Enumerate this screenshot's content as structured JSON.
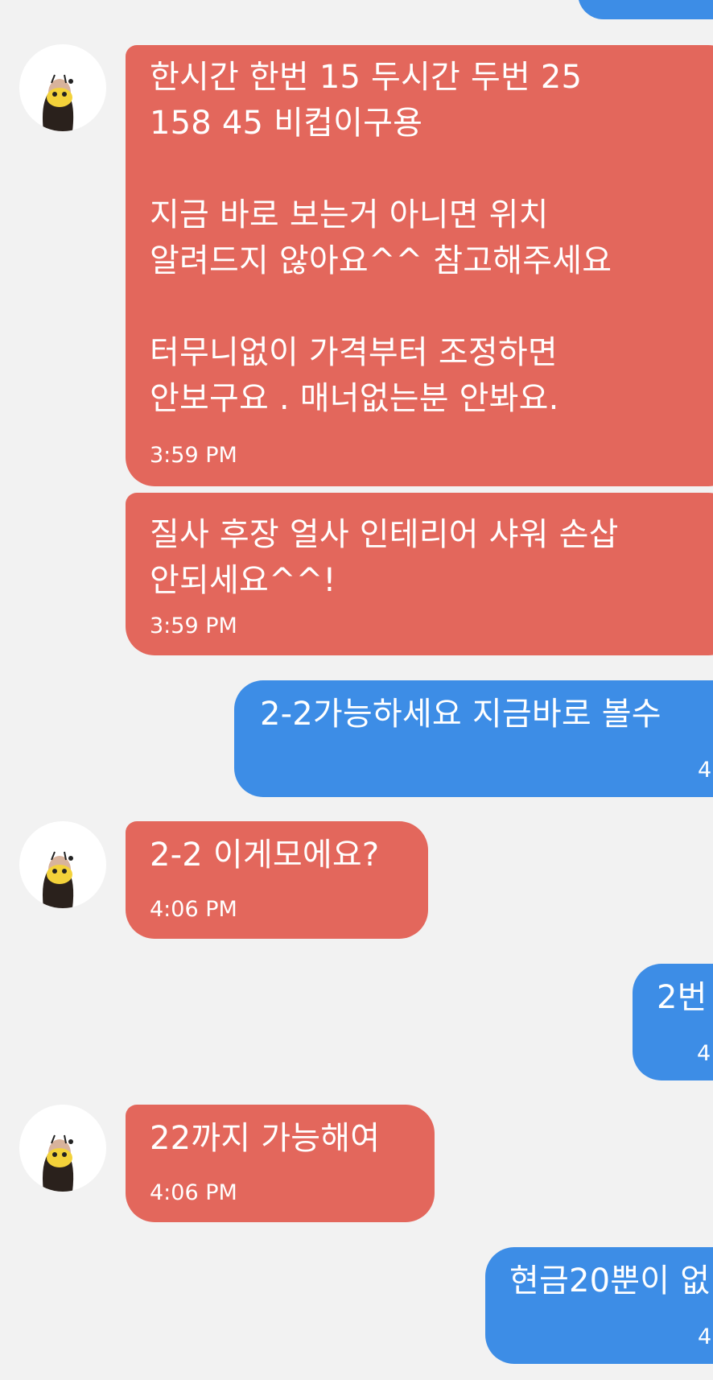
{
  "messages": [
    {
      "side": "out",
      "text": "",
      "time": ""
    },
    {
      "side": "in",
      "text": "한시간 한번 15 두시간 두번 25\n158 45 비컵이구용\n\n지금 바로 보는거 아니면 위치\n알려드지 않아요^^ 참고해주세요\n\n터무니없이 가격부터 조정하면\n안보구요 . 매너없는분 안봐요.",
      "time": "3:59 PM"
    },
    {
      "side": "in",
      "text": "질사 후장 얼사 인테리어 샤워 손삽\n안되세요^^!",
      "time": "3:59 PM"
    },
    {
      "side": "out",
      "text": "2-2가능하세요 지금바로 볼수",
      "time": "4"
    },
    {
      "side": "in",
      "text": "2-2 이게모에요?",
      "time": "4:06 PM"
    },
    {
      "side": "out",
      "text": "2번",
      "time": "4"
    },
    {
      "side": "in",
      "text": "22까지 가능해여",
      "time": "4:06 PM"
    },
    {
      "side": "out",
      "text": "현금20뿐이 없",
      "time": "4"
    }
  ],
  "colors": {
    "background": "#f2f2f2",
    "incoming_bubble": "#e3675c",
    "outgoing_bubble": "#3d8de6",
    "text": "#ffffff"
  },
  "icons": {
    "avatar": "contact-avatar-icon"
  }
}
